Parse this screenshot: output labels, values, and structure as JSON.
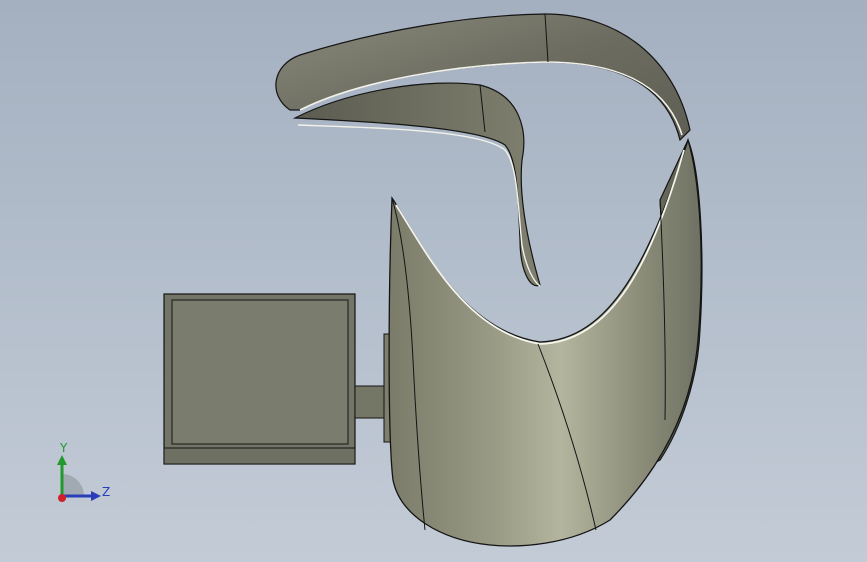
{
  "viewport": {
    "background_top": "#a4b0c0",
    "background_bottom": "#c3cbd6"
  },
  "model": {
    "body_color": "#8f907a",
    "body_highlight": "#b3b59e",
    "band_color": "#6c6c60",
    "box_color": "#6f7163",
    "edge_color": "#141414"
  },
  "triad": {
    "y_label": "Y",
    "z_label": "Z",
    "y_color": "#1f9a2b",
    "z_color": "#2a3db8",
    "x_color": "#d0202a",
    "y_icon": "y-axis-arrow",
    "z_icon": "z-axis-arrow",
    "x_icon": "x-axis-dot"
  }
}
